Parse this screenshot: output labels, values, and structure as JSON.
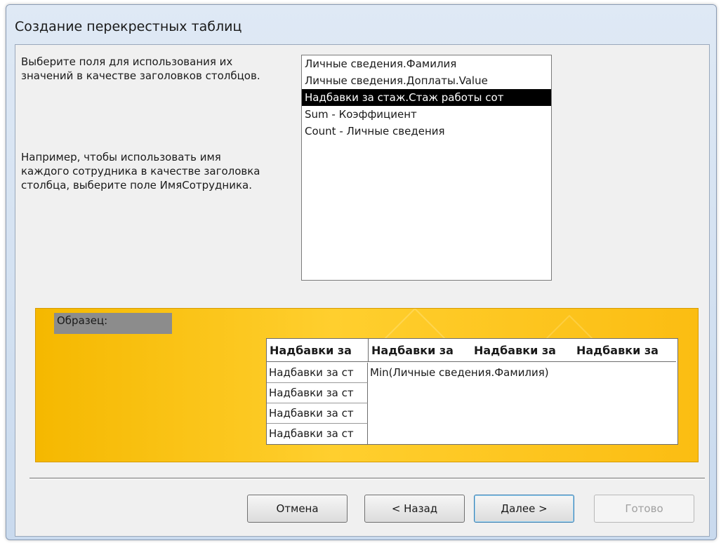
{
  "window": {
    "title": "Создание перекрестных таблиц"
  },
  "instructions": {
    "line1": "Выберите поля для использования их значений в качестве заголовков столбцов.",
    "line2": "Например, чтобы использовать имя каждого сотрудника в качестве заголовка столбца, выберите поле ИмяСотрудника."
  },
  "fields": [
    {
      "label": "Личные сведения.Фамилия",
      "selected": false
    },
    {
      "label": "Личные сведения.Доплаты.Value",
      "selected": false
    },
    {
      "label": "Надбавки за стаж.Стаж работы сот",
      "selected": true
    },
    {
      "label": "Sum - Коэффициент",
      "selected": false
    },
    {
      "label": "Count - Личные сведения",
      "selected": false
    }
  ],
  "sample": {
    "label": "Образец:",
    "headers": [
      "Надбавки за",
      "Надбавки за",
      "Надбавки за",
      "Надбавки за"
    ],
    "rows": [
      "Надбавки за ст",
      "Надбавки за ст",
      "Надбавки за ст",
      "Надбавки за ст"
    ],
    "value": "Min(Личные сведения.Фамилия)"
  },
  "buttons": {
    "cancel": "Отмена",
    "back": "< Назад",
    "next": "Далее >",
    "finish": "Готово"
  }
}
